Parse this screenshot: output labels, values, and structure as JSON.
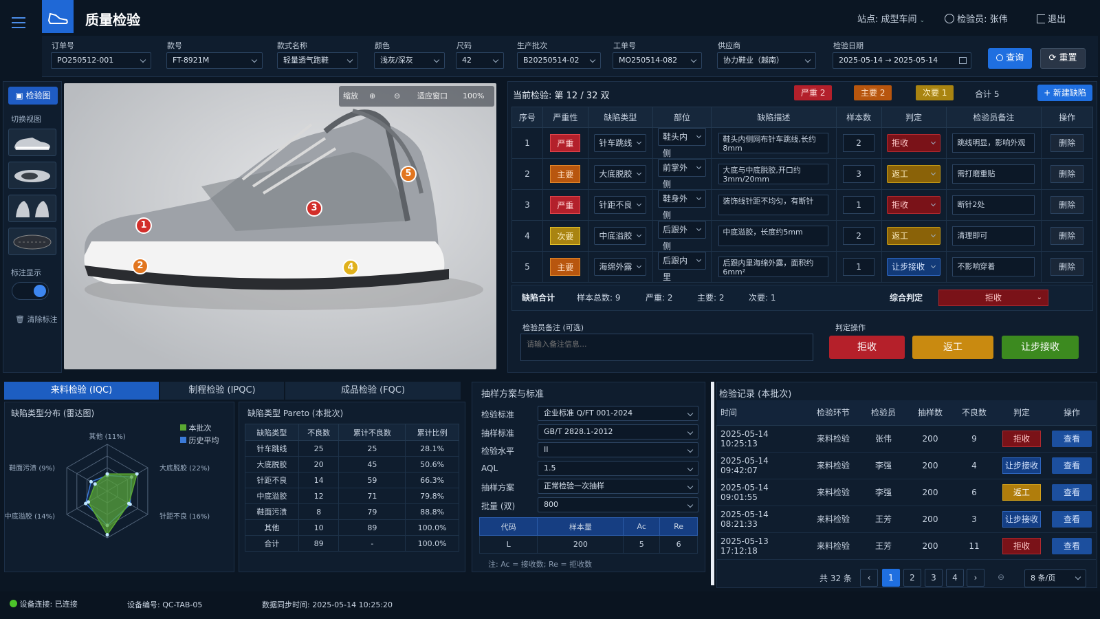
{
  "header": {
    "title": "质量检验",
    "station": "站点: 成型车间",
    "inspector": "检验员: 张伟",
    "logout": "退出"
  },
  "filters": {
    "order": {
      "label": "订单号",
      "value": "PO250512-001"
    },
    "style": {
      "label": "款号",
      "value": "FT-8921M"
    },
    "style_name": {
      "label": "款式名称",
      "value": "轻量透气跑鞋"
    },
    "color": {
      "label": "颜色",
      "value": "浅灰/深灰"
    },
    "size": {
      "label": "尺码",
      "value": "42"
    },
    "batch": {
      "label": "生产批次",
      "value": "B20250514-02"
    },
    "workorder": {
      "label": "工单号",
      "value": "MO250514-082"
    },
    "supplier": {
      "label": "供应商",
      "value": "协力鞋业（越南）"
    },
    "date": {
      "label": "检验日期",
      "from": "2025-05-14",
      "arrow": "→",
      "to": "2025-05-14"
    },
    "query": "查询",
    "reset": "重置"
  },
  "left": {
    "tab": "检验图",
    "switch_view": "切换视图",
    "mark_display": "标注显示",
    "clear": "清除标注"
  },
  "viewer": {
    "zoom_label": "缩放",
    "fit": "适应窗口",
    "zoom": "100%",
    "markers": [
      "1",
      "2",
      "3",
      "4",
      "5"
    ]
  },
  "current": {
    "label": "当前检验: 第 12 / 32 双",
    "serious": "严重 2",
    "major": "主要 2",
    "minor": "次要 1",
    "total": "合计 5",
    "new": "+ 新建缺陷"
  },
  "defect_table": {
    "headers": [
      "序号",
      "严重性",
      "缺陷类型",
      "部位",
      "缺陷描述",
      "样本数",
      "判定",
      "检验员备注",
      "操作"
    ],
    "rows": [
      {
        "no": "1",
        "sev": "严重",
        "type": "针车跳线",
        "part": "鞋头内侧",
        "desc": "鞋头内侧网布针车跳线,长约8mm",
        "n": "2",
        "judge": "拒收",
        "note": "跳线明显，影响外观",
        "op": "删除"
      },
      {
        "no": "2",
        "sev": "主要",
        "type": "大底脱胶",
        "part": "前掌外侧",
        "desc": "大底与中底脱胶,开口约3mm/20mm",
        "n": "3",
        "judge": "返工",
        "note": "需打磨重贴",
        "op": "删除"
      },
      {
        "no": "3",
        "sev": "严重",
        "type": "针距不良",
        "part": "鞋身外侧",
        "desc": "装饰线针距不均匀，有断针",
        "n": "1",
        "judge": "拒收",
        "note": "断针2处",
        "op": "删除"
      },
      {
        "no": "4",
        "sev": "次要",
        "type": "中底溢胶",
        "part": "后跟外侧",
        "desc": "中底溢胶，长度约5mm",
        "n": "2",
        "judge": "返工",
        "note": "清理即可",
        "op": "删除"
      },
      {
        "no": "5",
        "sev": "主要",
        "type": "海绵外露",
        "part": "后跟内里",
        "desc": "后跟内里海绵外露，面积约6mm²",
        "n": "1",
        "judge": "让步接收",
        "note": "不影响穿着",
        "op": "删除"
      }
    ]
  },
  "summary": {
    "label": "缺陷合计",
    "samples": "样本总数: 9",
    "serious": "严重: 2",
    "major": "主要: 2",
    "minor": "次要: 1",
    "overall_label": "综合判定",
    "overall": "拒收"
  },
  "remarks": {
    "label": "检验员备注 (可选)",
    "placeholder": "请输入备注信息...",
    "ops_label": "判定操作",
    "reject": "拒收",
    "rework": "返工",
    "concession": "让步接收"
  },
  "tabs": [
    "来料检验 (IQC)",
    "制程检验 (IPQC)",
    "成品检验 (FQC)"
  ],
  "radar": {
    "title": "缺陷类型分布 (雷达图)",
    "legend_current": "本批次",
    "legend_hist": "历史平均",
    "axes": [
      "其他 (11%)",
      "大底脱胶 (22%)",
      "针距不良 (16%)",
      "",
      "中底溢胶 (14%)",
      "鞋面污渍 (9%)"
    ],
    "current": [
      0.11,
      0.22,
      0.16,
      0.28,
      0.14,
      0.09
    ],
    "history": [
      0.1,
      0.18,
      0.17,
      0.22,
      0.16,
      0.12
    ],
    "max": 0.3,
    "color_current": "#5aa832",
    "color_hist": "#3b7ad8"
  },
  "pareto": {
    "title": "缺陷类型 Pareto (本批次)",
    "headers": [
      "缺陷类型",
      "不良数",
      "累计不良数",
      "累计比例"
    ],
    "rows": [
      [
        "针车跳线",
        "25",
        "25",
        "28.1%"
      ],
      [
        "大底脱胶",
        "20",
        "45",
        "50.6%"
      ],
      [
        "针距不良",
        "14",
        "59",
        "66.3%"
      ],
      [
        "中底溢胶",
        "12",
        "71",
        "79.8%"
      ],
      [
        "鞋面污渍",
        "8",
        "79",
        "88.8%"
      ],
      [
        "其他",
        "10",
        "89",
        "100.0%"
      ],
      [
        "合计",
        "89",
        "-",
        "100.0%"
      ]
    ]
  },
  "sampling": {
    "title": "抽样方案与标准",
    "fields": [
      [
        "检验标准",
        "企业标准 Q/FT 001-2024"
      ],
      [
        "抽样标准",
        "GB/T 2828.1-2012"
      ],
      [
        "检验水平",
        "II"
      ],
      [
        "AQL",
        "1.5"
      ],
      [
        "抽样方案",
        "正常检验一次抽样"
      ],
      [
        "批量 (双)",
        "800"
      ]
    ],
    "headers": [
      "代码",
      "样本量",
      "Ac",
      "Re"
    ],
    "row": [
      "L",
      "200",
      "5",
      "6"
    ],
    "note": "注: Ac = 接收数; Re = 拒收数"
  },
  "records": {
    "title": "检验记录 (本批次)",
    "headers": [
      "时间",
      "检验环节",
      "检验员",
      "抽样数",
      "不良数",
      "判定",
      "操作"
    ],
    "rows": [
      [
        "2025-05-14 10:25:13",
        "来料检验",
        "张伟",
        "200",
        "9",
        "拒收",
        "查看"
      ],
      [
        "2025-05-14 09:42:07",
        "来料检验",
        "李强",
        "200",
        "4",
        "让步接收",
        "查看"
      ],
      [
        "2025-05-14 09:01:55",
        "来料检验",
        "李强",
        "200",
        "6",
        "返工",
        "查看"
      ],
      [
        "2025-05-14 08:21:33",
        "来料检验",
        "王芳",
        "200",
        "3",
        "让步接收",
        "查看"
      ],
      [
        "2025-05-13 17:12:18",
        "来料检验",
        "王芳",
        "200",
        "11",
        "拒收",
        "查看"
      ]
    ],
    "total": "共 32 条",
    "pages": [
      "1",
      "2",
      "3",
      "4"
    ],
    "per_page": "8 条/页"
  },
  "status": {
    "conn": "设备连接: 已连接",
    "device": "设备编号: QC-TAB-05",
    "sync": "数据同步时间: 2025-05-14 10:25:20"
  }
}
